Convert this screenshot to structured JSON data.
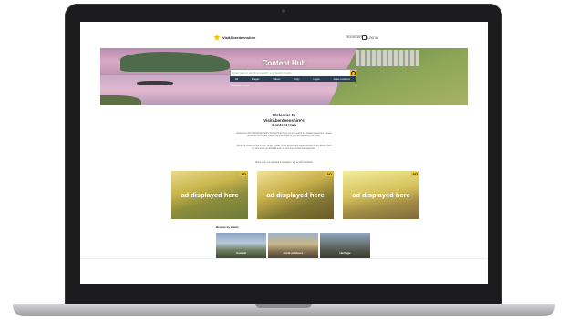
{
  "site": {
    "logo_text": "VisitAberdeenshire",
    "register": "REGISTER",
    "login": "LOG IN"
  },
  "hero": {
    "title": "Content Hub",
    "search_placeholder": "Enter tags or words to search, e.g. beach, castle",
    "filters": [
      "All",
      "Images",
      "Videos",
      "Copy",
      "Logos",
      "Asset Locations"
    ],
    "advanced": "Advanced search"
  },
  "welcome": {
    "line1": "Welcome to",
    "line2": "VisitAberdeenshire's",
    "line3": "Content Hub",
    "p1": "Welcome to the VisitAberdeenshire Content Hub! Here you can search our curated assets and request access to our images, videos, copy and logos to help tell Aberdeenshire's story.",
    "p2": "Using our content is free to use. Simply register for an account and request access to any assets. We'll be sure to let you know as soon as your request has been approved.",
    "p3": "Share what you uploaded to Instagram, tag us with #visitabdn"
  },
  "ads": [
    {
      "text": "ad displayed here",
      "badge": "AD"
    },
    {
      "text": "ad displayed here",
      "badge": "AD"
    },
    {
      "text": "ad displayed here",
      "badge": "AD"
    }
  ],
  "browse": {
    "label": "Browse by theme",
    "items": [
      "Coastal",
      "Great outdoors",
      "Heritage"
    ]
  },
  "colors": {
    "accent": "#f2c500",
    "filter_bar": "#2c3e50"
  }
}
